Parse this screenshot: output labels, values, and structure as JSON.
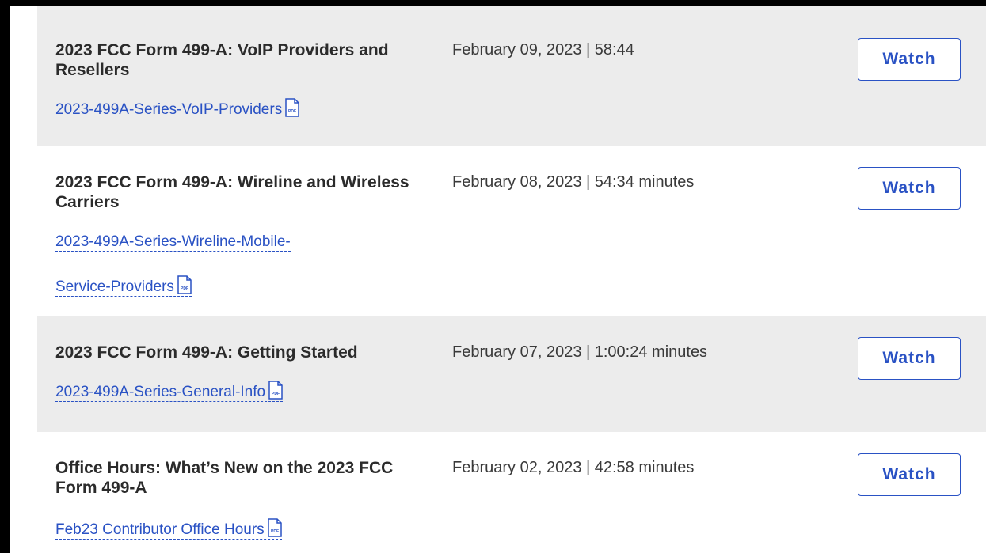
{
  "icons": {
    "pdf": "pdf-file-icon",
    "pdf_text": "PDF"
  },
  "colors": {
    "link": "#2a52c4",
    "row_shaded": "#ececec",
    "text": "#2b2b2b"
  },
  "webinars": [
    {
      "title": "2023 FCC Form 499-A: VoIP Providers and Resellers",
      "date_duration": "February 09, 2023 | 58:44",
      "link_lines": [
        "2023-499A-Series-VoIP-Providers"
      ],
      "watch_label": "Watch"
    },
    {
      "title": "2023 FCC Form 499-A: Wireline and Wireless Carriers",
      "date_duration": "February 08, 2023 | 54:34 minutes",
      "link_lines": [
        "2023-499A-Series-Wireline-Mobile-",
        "Service-Providers"
      ],
      "watch_label": "Watch"
    },
    {
      "title": "2023 FCC Form 499-A: Getting Started",
      "date_duration": "February 07, 2023 | 1:00:24 minutes",
      "link_lines": [
        "2023-499A-Series-General-Info"
      ],
      "watch_label": "Watch"
    },
    {
      "title": "Office Hours: What’s New on the 2023 FCC Form 499-A",
      "date_duration": "February 02, 2023 | 42:58 minutes",
      "link_lines": [
        "Feb23 Contributor Office Hours"
      ],
      "watch_label": "Watch"
    }
  ]
}
